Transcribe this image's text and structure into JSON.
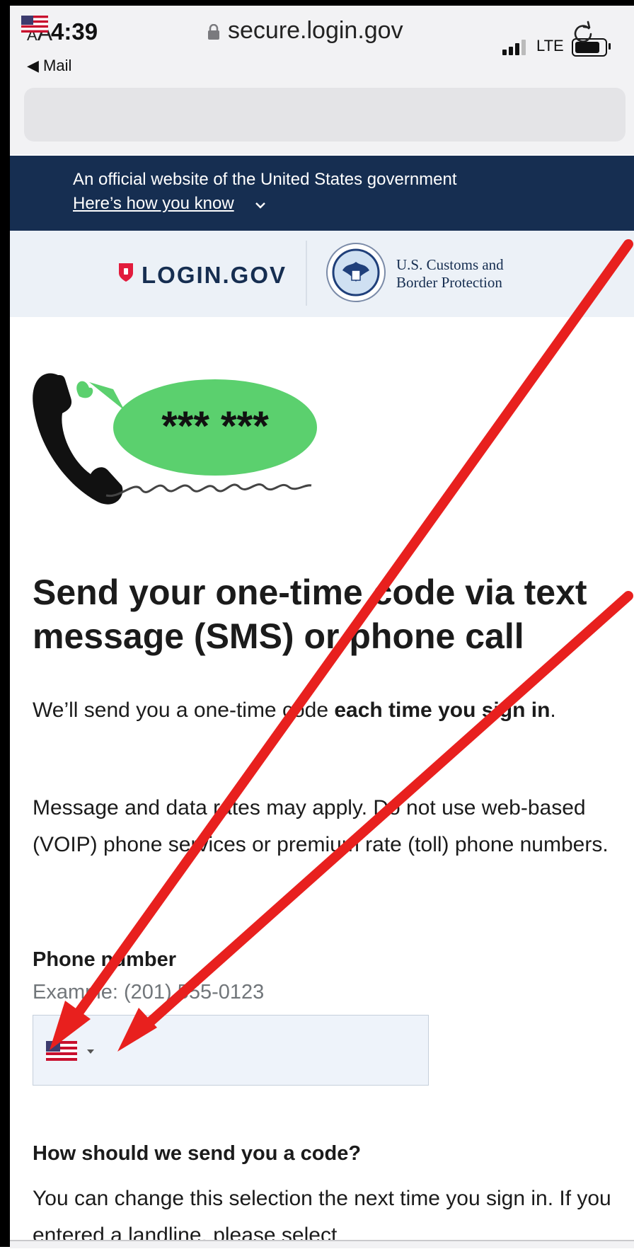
{
  "status_bar": {
    "time": "4:39",
    "back_label": "◀ Mail",
    "network": "LTE"
  },
  "url_bar": {
    "aa_small": "A",
    "aa_large": "A",
    "domain": "secure.login.gov"
  },
  "gov_banner": {
    "text": "An official website of the United States government",
    "link": "Here’s how you know"
  },
  "header": {
    "logo_text": "LOGIN.GOV",
    "agency_line1": "U.S. Customs and",
    "agency_line2": "Border Protection"
  },
  "illustration": {
    "code_text": "*** ***"
  },
  "main": {
    "headline": "Send your one-time code via text message (SMS) or phone call",
    "intro_before": "We’ll send you a one-time code ",
    "intro_bold": "each time you sign in",
    "intro_after": ".",
    "rates": "Message and data rates may apply. Do not use web-based (VOIP) phone services or premium rate (toll) phone numbers.",
    "phone_label": "Phone number",
    "phone_hint": "Example: (201) 555-0123",
    "phone_value": "",
    "how_label": "How should we send you a code?",
    "how_text": "You can change this selection the next time you sign in. If you entered a landline, please select"
  },
  "colors": {
    "banner_bg": "#162e51",
    "header_bg": "#ecf1f7",
    "bubble": "#5bd06e",
    "annotation_arrow": "#e8201e"
  }
}
